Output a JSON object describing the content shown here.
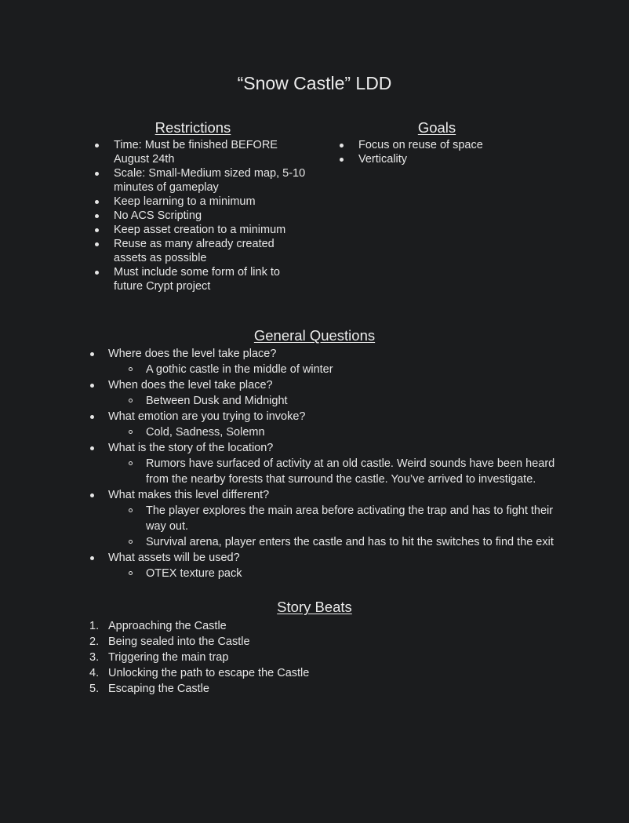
{
  "document": {
    "title": "“Snow Castle” LDD"
  },
  "restrictions": {
    "heading": "Restrictions",
    "items": [
      "Time: Must be finished BEFORE August 24th",
      "Scale: Small-Medium sized map, 5-10 minutes of gameplay",
      "Keep learning to a minimum",
      "No ACS Scripting",
      "Keep asset creation to a minimum",
      "Reuse as many already created assets as possible",
      "Must include some form of link to future Crypt project"
    ]
  },
  "goals": {
    "heading": "Goals",
    "items": [
      "Focus on reuse of space",
      "Verticality"
    ]
  },
  "general_questions": {
    "heading": "General Questions",
    "items": [
      {
        "q": "Where does the level take place?",
        "a": [
          "A gothic castle in the middle of winter"
        ]
      },
      {
        "q": "When does the level take place?",
        "a": [
          "Between Dusk and Midnight"
        ]
      },
      {
        "q": "What emotion are you trying to invoke?",
        "a": [
          "Cold, Sadness, Solemn"
        ]
      },
      {
        "q": "What is the story of the location?",
        "a": [
          "Rumors have surfaced of activity at an old castle. Weird sounds have been heard from the nearby forests that surround the castle. You’ve arrived to investigate."
        ]
      },
      {
        "q": "What makes this level different?",
        "a": [
          "The player explores the main area before activating the trap and has to fight their way out.",
          "Survival arena, player enters the castle and has to hit the switches to find the exit"
        ]
      },
      {
        "q": "What assets will be used?",
        "a": [
          "OTEX texture pack"
        ]
      }
    ]
  },
  "story_beats": {
    "heading": "Story Beats",
    "items": [
      "Approaching the Castle",
      "Being sealed into the Castle",
      "Triggering the main trap",
      "Unlocking the path to escape the Castle",
      "Escaping the Castle"
    ]
  }
}
